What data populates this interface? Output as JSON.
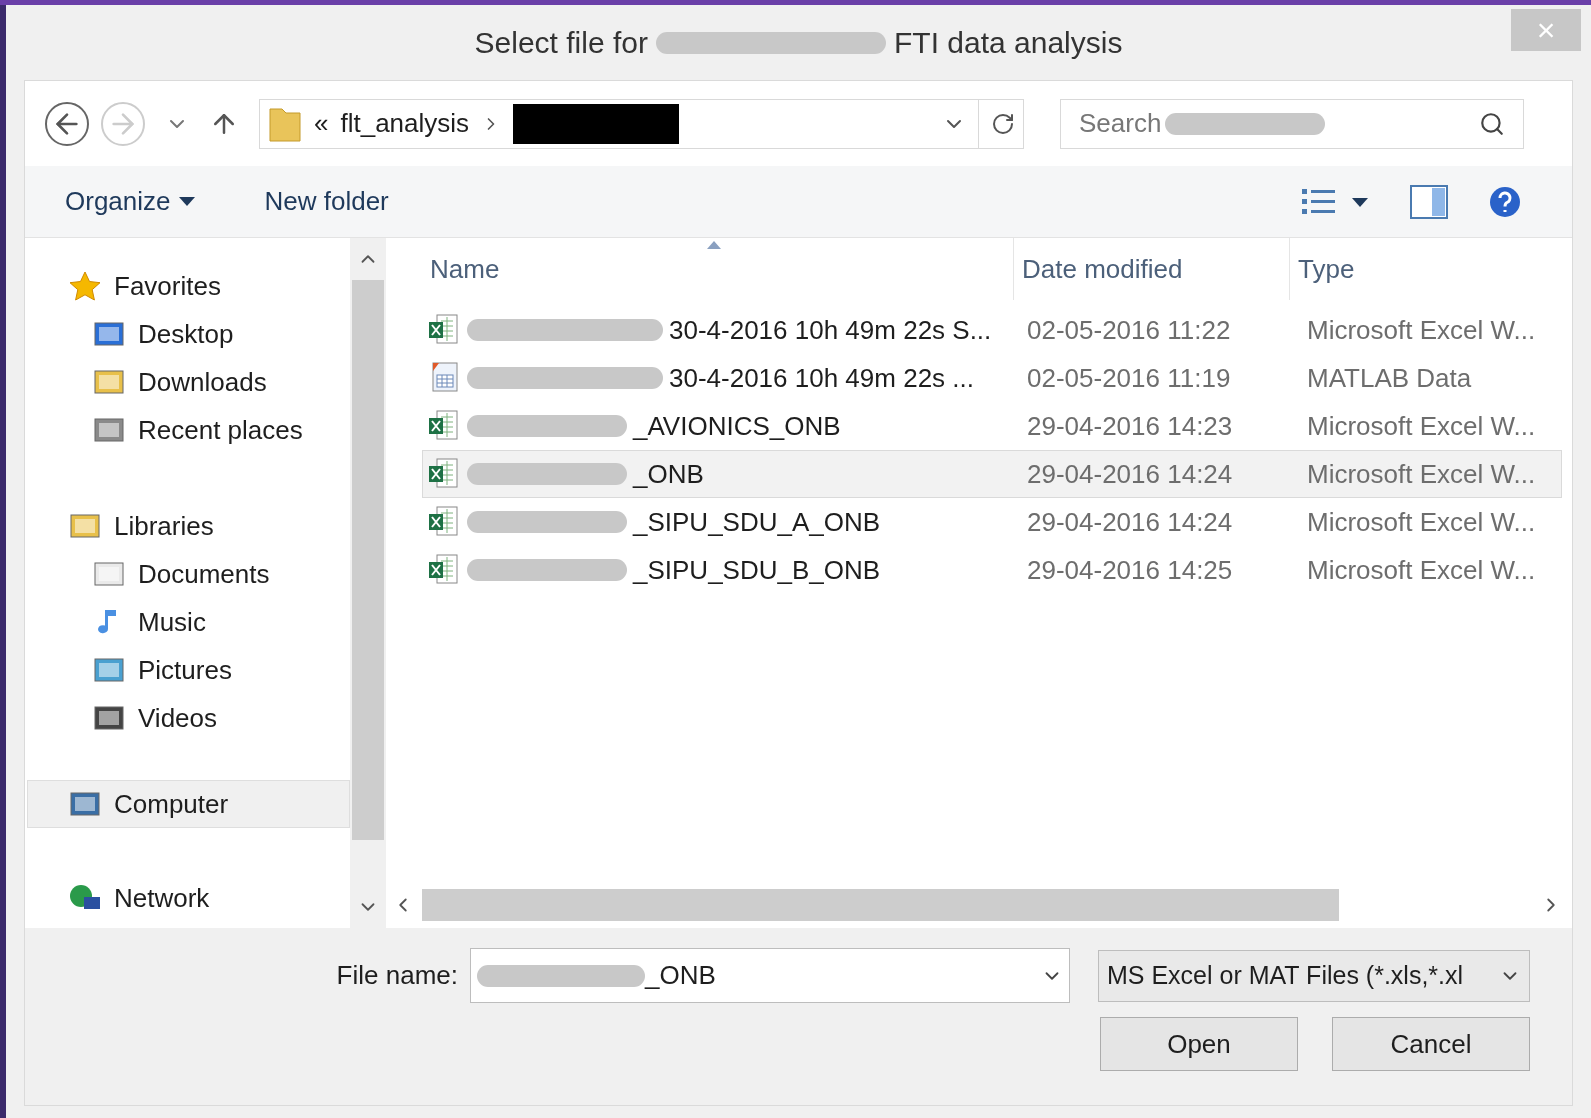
{
  "window": {
    "title_start": "Select file for",
    "title_end": "FTI data analysis",
    "close": "×"
  },
  "nav": {
    "breadcrumb_prefix": "«",
    "folder": "flt_analysis",
    "search_placeholder": "Search"
  },
  "toolbar": {
    "organize": "Organize",
    "new_folder": "New folder"
  },
  "sidebar": [
    {
      "label": "Favorites",
      "selected": false,
      "children": [
        {
          "label": "Desktop",
          "selected": false
        },
        {
          "label": "Downloads",
          "selected": false
        },
        {
          "label": "Recent places",
          "selected": false
        }
      ]
    },
    {
      "label": "Libraries",
      "selected": false,
      "children": [
        {
          "label": "Documents",
          "selected": false
        },
        {
          "label": "Music",
          "selected": false
        },
        {
          "label": "Pictures",
          "selected": false
        },
        {
          "label": "Videos",
          "selected": false
        }
      ]
    },
    {
      "label": "Computer",
      "selected": true
    },
    {
      "label": "Network",
      "selected": false
    }
  ],
  "columns": [
    "Name",
    "Date modified",
    "Type"
  ],
  "rows": [
    {
      "kind": "excel",
      "name": "30-4-2016 10h 49m 22s S...",
      "date": "02-05-2016 11:22",
      "type": "Microsoft Excel W...",
      "selected": false
    },
    {
      "kind": "mat",
      "name": "30-4-2016 10h 49m 22s ...",
      "date": "02-05-2016 11:19",
      "type": "MATLAB Data",
      "selected": false
    },
    {
      "kind": "excel",
      "name": "_AVIONICS_ONB",
      "date": "29-04-2016 14:23",
      "type": "Microsoft Excel W...",
      "selected": false
    },
    {
      "kind": "excel",
      "name": "_ONB",
      "date": "29-04-2016 14:24",
      "type": "Microsoft Excel W...",
      "selected": true
    },
    {
      "kind": "excel",
      "name": "_SIPU_SDU_A_ONB",
      "date": "29-04-2016 14:24",
      "type": "Microsoft Excel W...",
      "selected": false
    },
    {
      "kind": "excel",
      "name": "_SIPU_SDU_B_ONB",
      "date": "29-04-2016 14:25",
      "type": "Microsoft Excel W...",
      "selected": false
    }
  ],
  "footer": {
    "file_name_label": "File name:",
    "file_name_value": "_ONB",
    "file_type": "MS Excel or MAT Files (*.xls,*.xl",
    "open": "Open",
    "cancel": "Cancel"
  }
}
